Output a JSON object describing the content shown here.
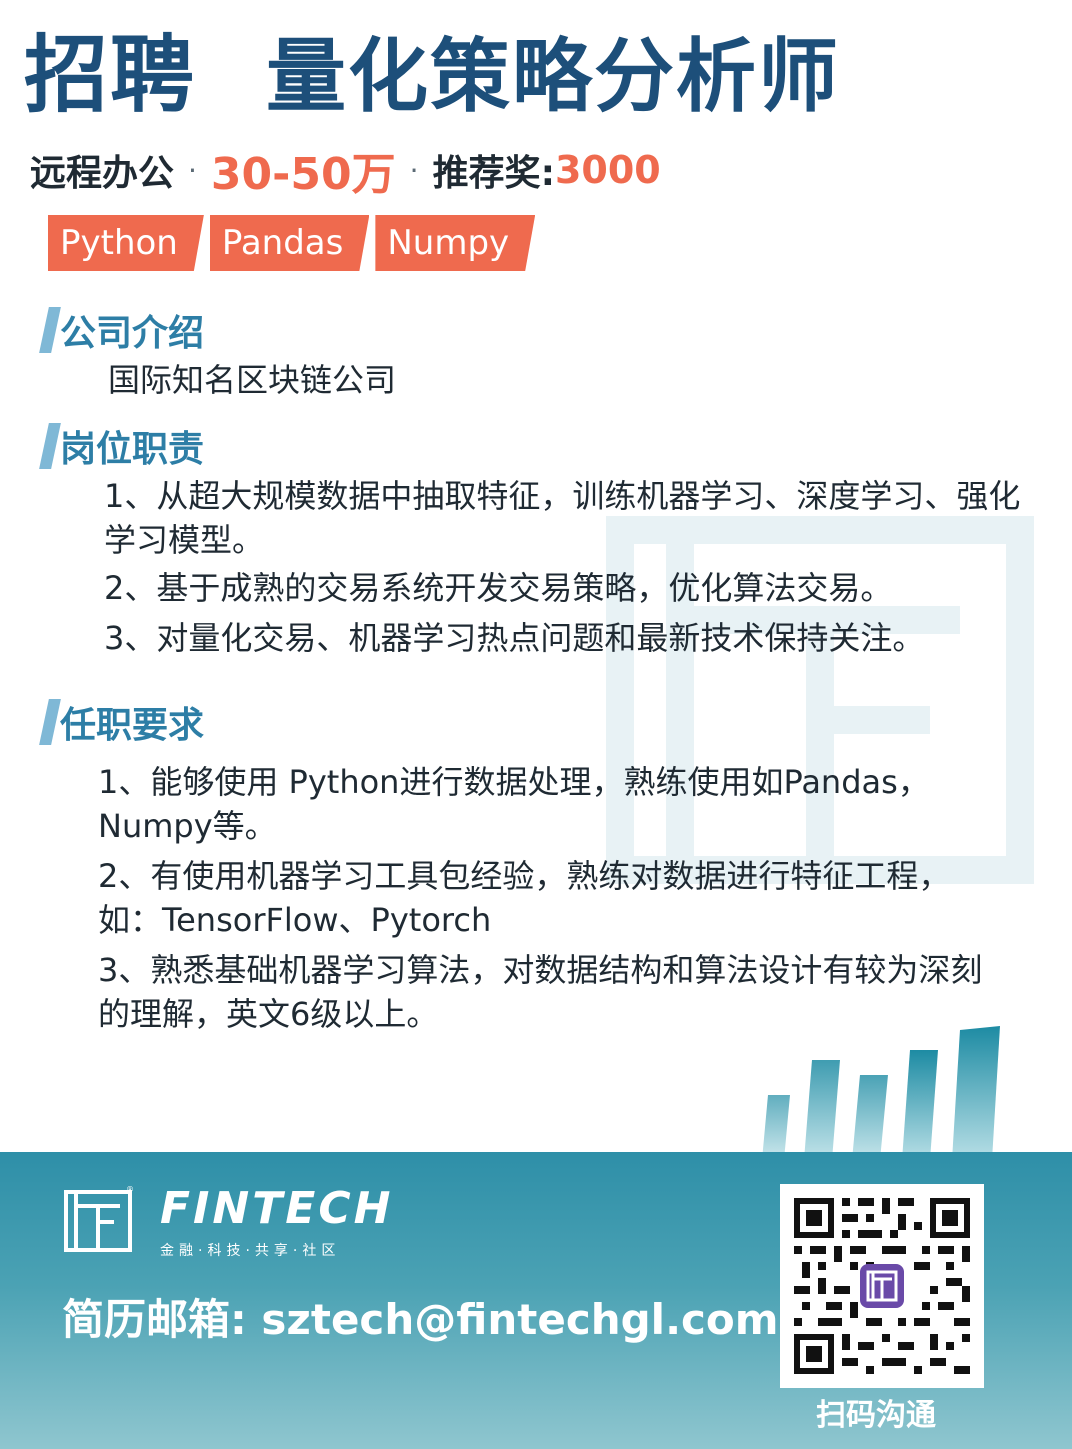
{
  "title": {
    "main": "招聘",
    "role": "量化策略分析师"
  },
  "meta": {
    "work_mode": "远程办公",
    "separator": "·",
    "salary": "30-50万",
    "bonus_label": "推荐奖:",
    "bonus_value": "3000"
  },
  "tags": [
    "Python",
    "Pandas",
    "Numpy"
  ],
  "company": {
    "heading": "公司介绍",
    "text": "国际知名区块链公司"
  },
  "duties": {
    "heading": "岗位职责",
    "items": [
      "1、从超大规模数据中抽取特征，训练机器学习、深度学习、强化学习模型。",
      "2、基于成熟的交易系统开发交易策略，优化算法交易。",
      "3、对量化交易、机器学习热点问题和最新技术保持关注。"
    ]
  },
  "requirements": {
    "heading": "任职要求",
    "items": [
      "1、能够使用 Python进行数据处理，熟练使用如Pandas，Numpy等。",
      "2、有使用机器学习工具包经验，熟练对数据进行特征工程，如：TensorFlow、Pytorch",
      "3、熟悉基础机器学习算法，对数据结构和算法设计有较为深刻的理解，英文6级以上。"
    ]
  },
  "footer": {
    "brand": "FINTECH",
    "slogan": "金融·科技·共享·社区",
    "email_label": "简历邮箱:",
    "email": "sztech@fintechgl.com",
    "qr_caption": "扫码沟通"
  },
  "colors": {
    "title": "#1d4f7a",
    "accent": "#ef6a4e",
    "section": "#2d7ea6",
    "footer": "#3a97ad"
  }
}
